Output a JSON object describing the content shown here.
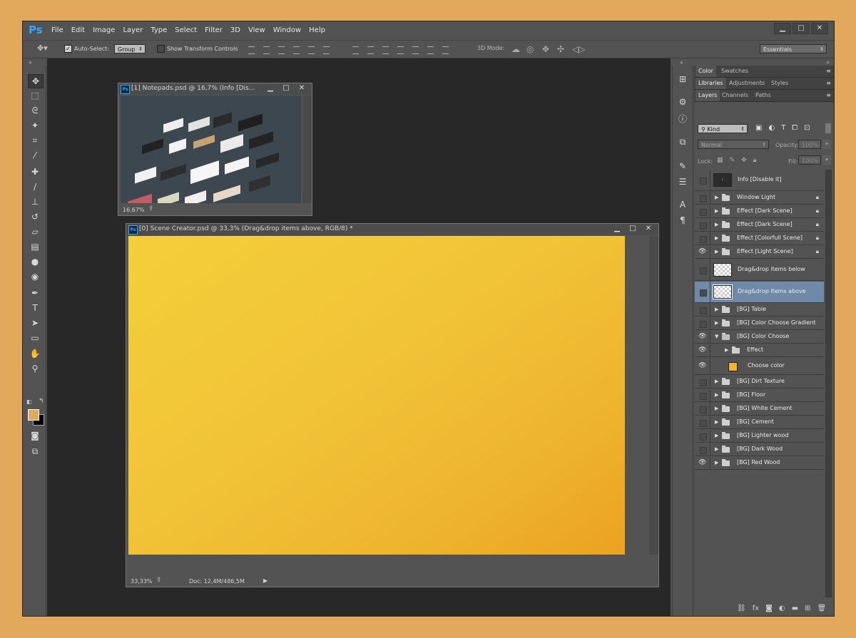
{
  "app": {
    "logo": "Ps",
    "menu": [
      "File",
      "Edit",
      "Image",
      "Layer",
      "Type",
      "Select",
      "Filter",
      "3D",
      "View",
      "Window",
      "Help"
    ],
    "window_controls": [
      "▁",
      "□",
      "✕"
    ]
  },
  "options_bar": {
    "auto_select_label": "Auto-Select:",
    "auto_select_checked": true,
    "auto_select_value": "Group",
    "show_transform_label": "Show Transform Controls",
    "mode3d_label": "3D Mode:",
    "workspace_value": "Essentials"
  },
  "tools": [
    {
      "name": "move-tool-icon",
      "glyph": "✥",
      "selected": true
    },
    {
      "name": "marquee-tool-icon",
      "glyph": "⬚"
    },
    {
      "name": "lasso-tool-icon",
      "glyph": "ᘓ"
    },
    {
      "name": "magic-wand-tool-icon",
      "glyph": "✦"
    },
    {
      "name": "crop-tool-icon",
      "glyph": "⌗"
    },
    {
      "name": "eyedropper-tool-icon",
      "glyph": "⁄"
    },
    {
      "name": "healing-brush-tool-icon",
      "glyph": "✚"
    },
    {
      "name": "brush-tool-icon",
      "glyph": "∕"
    },
    {
      "name": "clone-stamp-tool-icon",
      "glyph": "⊥"
    },
    {
      "name": "history-brush-tool-icon",
      "glyph": "↺"
    },
    {
      "name": "eraser-tool-icon",
      "glyph": "▱"
    },
    {
      "name": "gradient-tool-icon",
      "glyph": "▤"
    },
    {
      "name": "blur-tool-icon",
      "glyph": "●"
    },
    {
      "name": "dodge-tool-icon",
      "glyph": "◉"
    },
    {
      "name": "pen-tool-icon",
      "glyph": "✒"
    },
    {
      "name": "type-tool-icon",
      "glyph": "T"
    },
    {
      "name": "path-selection-tool-icon",
      "glyph": "➤"
    },
    {
      "name": "rectangle-tool-icon",
      "glyph": "▭"
    },
    {
      "name": "hand-tool-icon",
      "glyph": "✋"
    },
    {
      "name": "zoom-tool-icon",
      "glyph": "⚲"
    }
  ],
  "colors": {
    "foreground": "#e2a95c",
    "background": "#000000",
    "canvas_light": "#f3cf3a",
    "canvas_dark": "#eba220",
    "selection": "#6f8aa8"
  },
  "doc_small": {
    "title": "[1] Notepads.psd @ 16,7% (Info [Dis...",
    "zoom": "16,67%",
    "icon": "Ps"
  },
  "doc_main": {
    "title": "[0] Scene Creator.psd @ 33,3% (Drag&drop items above, RGB/8) *",
    "zoom": "33,33%",
    "doc_info": "Doc: 12,4M/486,5M",
    "icon": "Ps"
  },
  "panels": {
    "top_tabs": [
      "Color",
      "Swatches"
    ],
    "mid_tabs": [
      "Libraries",
      "Adjustments",
      "Styles"
    ],
    "layer_tabs": [
      "Layers",
      "Channels",
      "Paths"
    ],
    "kind_label": "Kind",
    "blend_mode": "Normal",
    "opacity_label": "Opacity:",
    "opacity_value": "100%",
    "lock_label": "Lock:",
    "fill_label": "Fill:",
    "fill_value": "100%"
  },
  "layers": [
    {
      "name": "Info [Disable it]",
      "visible": false,
      "thumb": "dark",
      "thumb_text": "i",
      "tall": true
    },
    {
      "name": "Window Light",
      "visible": false,
      "folder": true,
      "locked": true
    },
    {
      "name": "Effect [Dark Scene]",
      "visible": false,
      "folder": true,
      "locked": true
    },
    {
      "name": "Effect [Dark Scene]",
      "visible": false,
      "folder": true,
      "locked": true
    },
    {
      "name": "Effect [Colorfull Scene]",
      "visible": false,
      "folder": true,
      "locked": true
    },
    {
      "name": "Effect [Light Scene]",
      "visible": true,
      "folder": true,
      "locked": true
    },
    {
      "name": "Drag&drop items below",
      "visible": false,
      "thumb": "checker",
      "tall": true
    },
    {
      "name": "Drag&drop items above",
      "visible": false,
      "thumb": "checker",
      "tall": true,
      "selected": true
    },
    {
      "name": "[BG] Table",
      "visible": false,
      "folder": true
    },
    {
      "name": "[BG] Color Choose Gradient",
      "visible": false,
      "folder": true
    },
    {
      "name": "[BG] Color Choose",
      "visible": true,
      "folder": true,
      "open": true
    },
    {
      "name": "Effect",
      "visible": true,
      "folder": true,
      "indent": true
    },
    {
      "name": "Choose color",
      "visible": true,
      "swatch": true,
      "indent": true,
      "tallish": true
    },
    {
      "name": "[BG] Dirt Texture",
      "visible": false,
      "folder": true
    },
    {
      "name": "[BG] Floor",
      "visible": false,
      "folder": true
    },
    {
      "name": "[BG] White Cement",
      "visible": false,
      "folder": true
    },
    {
      "name": "[BG] Cement",
      "visible": false,
      "folder": true
    },
    {
      "name": "[BG] Lighter wood",
      "visible": false,
      "folder": true
    },
    {
      "name": "[BG] Dark Wood",
      "visible": false,
      "folder": true
    },
    {
      "name": "[BG] Red Wood",
      "visible": true,
      "folder": true
    }
  ]
}
